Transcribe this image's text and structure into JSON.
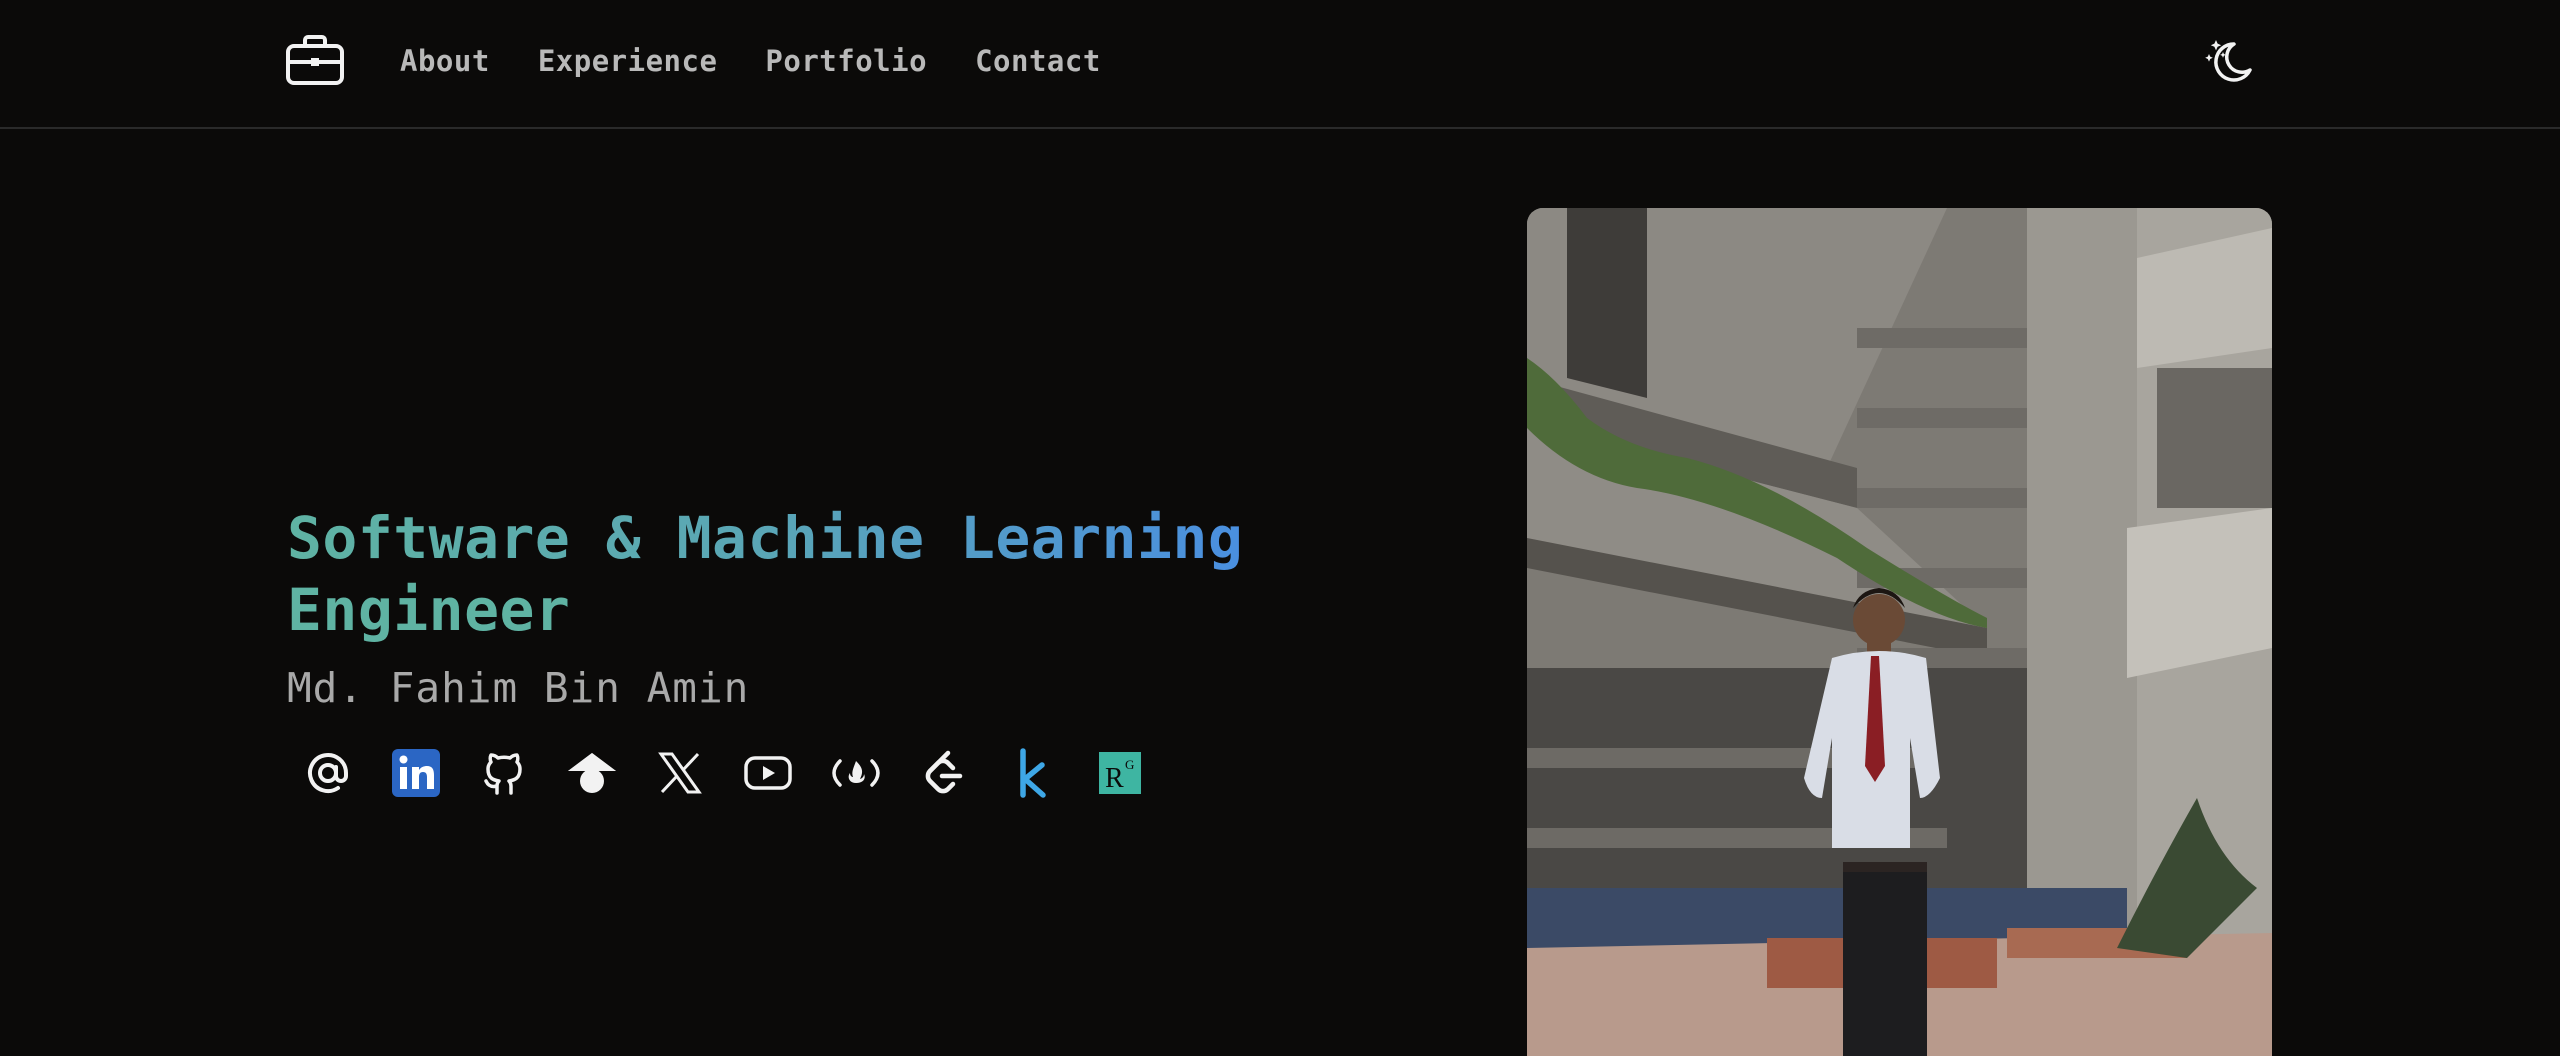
{
  "nav": {
    "items": [
      {
        "label": "About"
      },
      {
        "label": "Experience"
      },
      {
        "label": "Portfolio"
      },
      {
        "label": "Contact"
      }
    ]
  },
  "hero": {
    "title_line1": "Software & Machine Learning",
    "title_line2": "Engineer",
    "name": "Md. Fahim Bin Amin"
  },
  "socials": [
    {
      "icon": "email-icon"
    },
    {
      "icon": "linkedin-icon"
    },
    {
      "icon": "github-icon"
    },
    {
      "icon": "google-scholar-icon"
    },
    {
      "icon": "x-twitter-icon"
    },
    {
      "icon": "youtube-icon"
    },
    {
      "icon": "freecodecamp-icon"
    },
    {
      "icon": "leetcode-icon"
    },
    {
      "icon": "kaggle-icon"
    },
    {
      "icon": "researchgate-icon"
    }
  ],
  "colors": {
    "background": "#0b0a09",
    "accent_teal": "#5fb3a3",
    "accent_blue": "#4a8fe0",
    "nav_text": "#b9b9b9",
    "linkedin": "#2b66c4",
    "kaggle": "#3ea7e6",
    "researchgate": "#3eb5a2"
  }
}
